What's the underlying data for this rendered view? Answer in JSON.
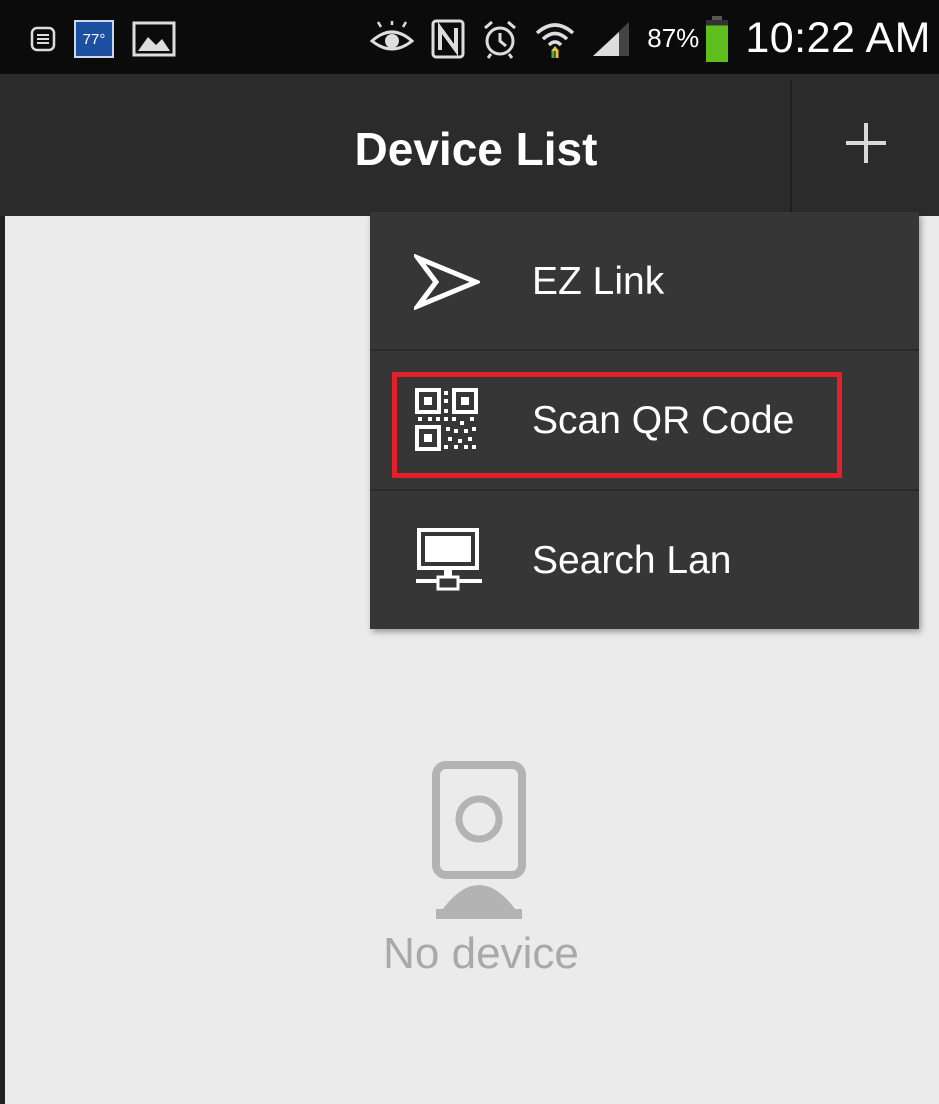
{
  "status_bar": {
    "temperature": "77°",
    "battery_percent": "87%",
    "time": "10:22 AM",
    "left_icons": [
      "notes-icon",
      "weather-icon",
      "gallery-icon"
    ],
    "right_icons": [
      "eye-icon",
      "nfc-icon",
      "alarm-icon",
      "wifi-icon",
      "signal-icon",
      "battery-icon"
    ],
    "battery_level": 0.87
  },
  "action_bar": {
    "title": "Device List",
    "add_icon": "plus-icon"
  },
  "menu": {
    "items": [
      {
        "label": "EZ Link",
        "icon": "send-arrow-icon"
      },
      {
        "label": "Scan QR Code",
        "icon": "qr-code-icon",
        "highlighted": true
      },
      {
        "label": "Search Lan",
        "icon": "network-monitor-icon"
      }
    ]
  },
  "empty_state": {
    "icon": "camera-icon",
    "text": "No device"
  },
  "colors": {
    "status_bar_bg": "#0b0b0b",
    "action_bar_bg": "#2b2b2b",
    "menu_bg": "#363636",
    "content_bg": "#ebebeb",
    "highlight": "#e3202a",
    "battery": "#5fbf1d"
  }
}
